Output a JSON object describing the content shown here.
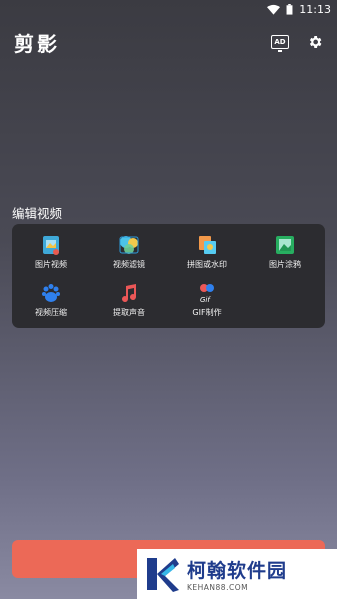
{
  "status_bar": {
    "time": "11:13",
    "icons": [
      "wifi-icon",
      "battery-icon"
    ]
  },
  "app_bar": {
    "title": "剪影",
    "ad_label": "AD",
    "icons": [
      "ad-icon",
      "gear-icon"
    ]
  },
  "section": {
    "title": "编辑视频"
  },
  "tools": [
    {
      "label": "图片视频",
      "icon": "photo-video-icon"
    },
    {
      "label": "视频滤镜",
      "icon": "video-filter-icon"
    },
    {
      "label": "拼图或水印",
      "icon": "collage-watermark-icon"
    },
    {
      "label": "图片涂鸦",
      "icon": "image-doodle-icon"
    },
    {
      "label": "视频压缩",
      "icon": "video-compress-icon"
    },
    {
      "label": "提取声音",
      "icon": "extract-audio-icon"
    },
    {
      "label": "GIF制作",
      "icon": "gif-maker-icon"
    }
  ],
  "colors": {
    "accent": "#ec6957",
    "panel": "#2c2c30"
  },
  "watermark": {
    "title": "柯翰软件园",
    "subtitle": "KEHAN88.COM"
  }
}
